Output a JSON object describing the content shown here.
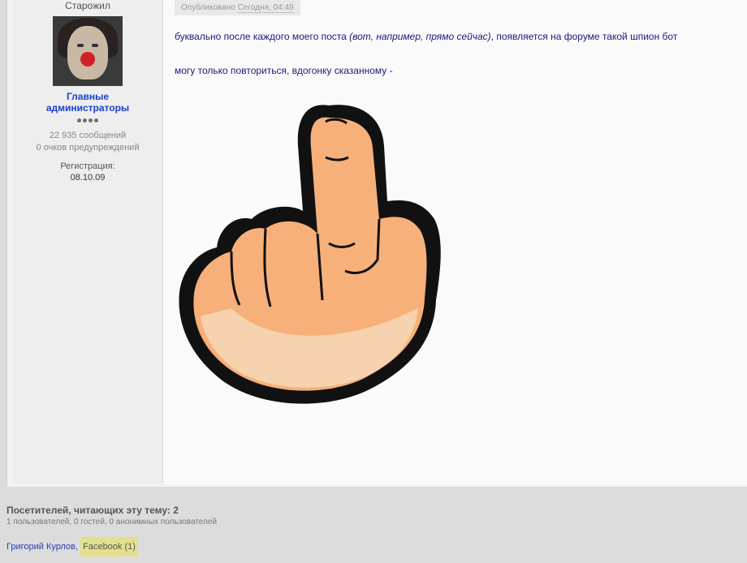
{
  "author": {
    "rank": "Старожил",
    "group_line1": "Главные",
    "group_line2": "администраторы",
    "posts": "22 935 сообщений",
    "warnings": "0 очков предупреждений",
    "reg_label": "Регистрация:",
    "reg_date": "08.10.09"
  },
  "post": {
    "meta_prefix": "Опубликовано",
    "meta_time": "Сегодня, 04:49",
    "p1_start": "буквально после каждого моего поста ",
    "p1_italic": "(вот, например, прямо сейчас)",
    "p1_end": ", появляется на форуме такой шпион бот",
    "p2": "могу только повториться, вдогонку сказанному -"
  },
  "footer": {
    "title": "Посетителей, читающих эту тему: 2",
    "subtitle": "1 пользователей, 0 гостей, 0 анонимных пользователей",
    "user": "Григорий Курлов",
    "separator": ",",
    "bot": "Facebook (1)"
  }
}
